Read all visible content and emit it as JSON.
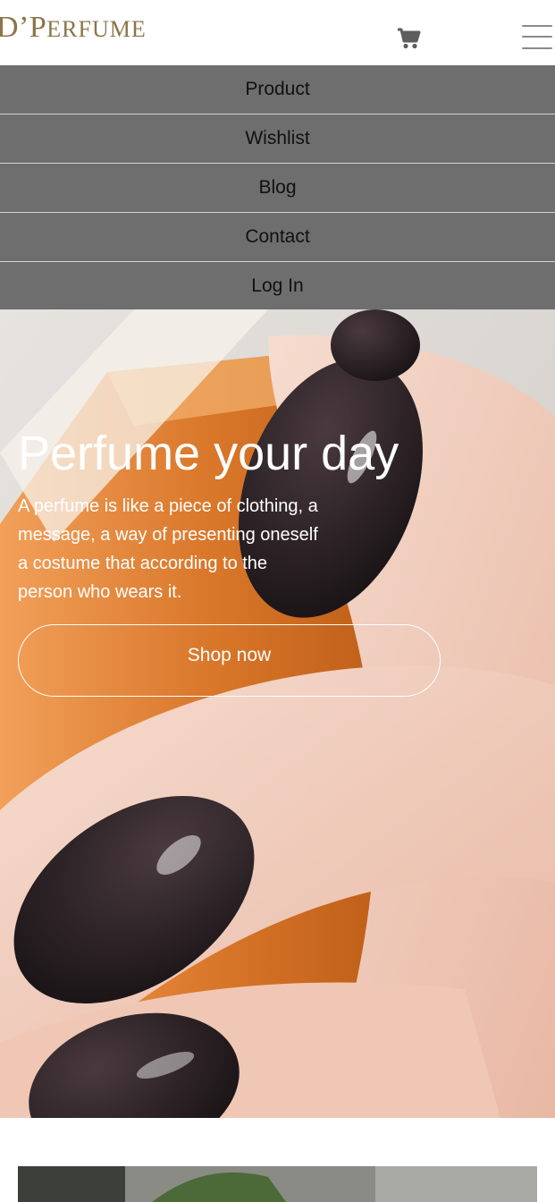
{
  "brand": {
    "logo_text": "D’PERFUME",
    "logo_color": "#8b7548"
  },
  "header": {
    "cart_icon": "shopping-cart-icon",
    "menu_icon": "hamburger-menu-icon"
  },
  "nav": {
    "background": "#6e6e6e",
    "items": [
      {
        "label": "Product"
      },
      {
        "label": "Wishlist"
      },
      {
        "label": "Blog"
      },
      {
        "label": "Contact"
      },
      {
        "label": "Log In"
      }
    ]
  },
  "hero": {
    "title": "Perfume your day",
    "text_lines": [
      "A perfume is like a piece of clothing, a",
      "message, a way of presenting oneself",
      "a costume that according to the",
      "person who wears it."
    ],
    "button_label": "Shop now"
  }
}
